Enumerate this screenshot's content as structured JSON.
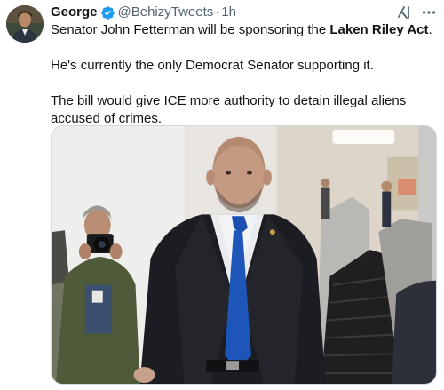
{
  "author": {
    "display_name": "George",
    "handle": "@BehizyTweets",
    "separator": "·",
    "timestamp": "1h",
    "verified": true
  },
  "tweet": {
    "line1_prefix": "Senator John Fetterman will be sponsoring the ",
    "line1_bold": "Laken Riley Act",
    "line1_suffix": ".",
    "paragraph2": "He's currently the only Democrat Senator supporting it.",
    "paragraph3": "The bill would give ICE more authority to detain illegal aliens accused of crimes."
  },
  "icons": {
    "verified": "verified-badge-icon",
    "grok": "grok-icon",
    "more": "more-options-icon"
  },
  "colors": {
    "text": "#0f1419",
    "secondary": "#536471",
    "verified_blue": "#1d9bf0",
    "media_border": "#cfd9de"
  }
}
